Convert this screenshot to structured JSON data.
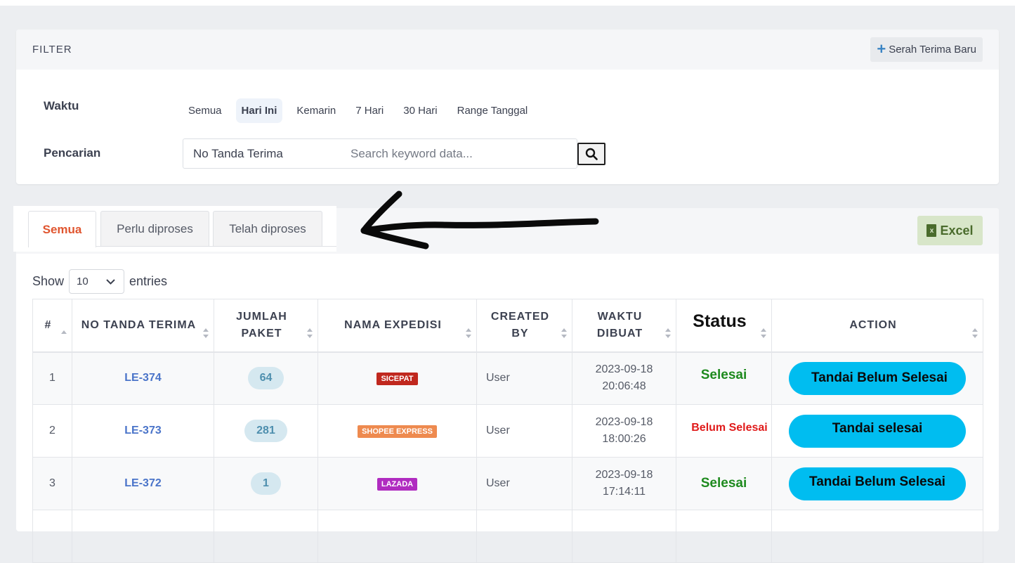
{
  "filter": {
    "title": "FILTER",
    "new_button": "Serah Terima Baru",
    "waktu_label": "Waktu",
    "pencarian_label": "Pencarian",
    "time_options": [
      "Semua",
      "Hari Ini",
      "Kemarin",
      "7 Hari",
      "30 Hari",
      "Range Tanggal"
    ],
    "active_time_option": "Hari Ini",
    "search_type": "No Tanda Terima",
    "search_placeholder": "Search keyword data..."
  },
  "tabs": [
    "Semua",
    "Perlu diproses",
    "Telah diproses"
  ],
  "active_tab": "Semua",
  "excel_button": "Excel",
  "show_entries": {
    "show": "Show",
    "value": "10",
    "entries": "entries"
  },
  "table": {
    "headers": {
      "num": "#",
      "no": "NO TANDA TERIMA",
      "jumlah_1": "JUMLAH",
      "jumlah_2": "PAKET",
      "expedisi": "NAMA EXPEDISI",
      "created_1": "CREATED",
      "created_2": "BY",
      "waktu_1": "WAKTU",
      "waktu_2": "DIBUAT",
      "status": "Status",
      "action": "ACTION"
    },
    "rows": [
      {
        "num": "1",
        "no": "LE-374",
        "paket": "64",
        "expedisi": "SICEPAT",
        "expedisi_color": "#c0281e",
        "created_by": "User",
        "date": "2023-09-18",
        "time": "20:06:48",
        "status": "Selesai",
        "action": "Tandai Belum Selesai"
      },
      {
        "num": "2",
        "no": "LE-373",
        "paket": "281",
        "expedisi": "SHOPEE EXPRESS",
        "expedisi_color": "#ee8a4f",
        "created_by": "User",
        "date": "2023-09-18",
        "time": "18:00:26",
        "status": "Belum Selesai",
        "action": "Tandai selesai"
      },
      {
        "num": "3",
        "no": "LE-372",
        "paket": "1",
        "expedisi": "LAZADA",
        "expedisi_color": "#b02cc0",
        "created_by": "User",
        "date": "2023-09-18",
        "time": "17:14:11",
        "status": "Selesai",
        "action": "Tandai Belum Selesai"
      }
    ]
  },
  "colors": {
    "accent_tab": "#e0552f",
    "link": "#4a74c9",
    "action_button": "#00bdf0",
    "status_done": "#1e8a1e",
    "status_pending": "#e01a1a"
  }
}
